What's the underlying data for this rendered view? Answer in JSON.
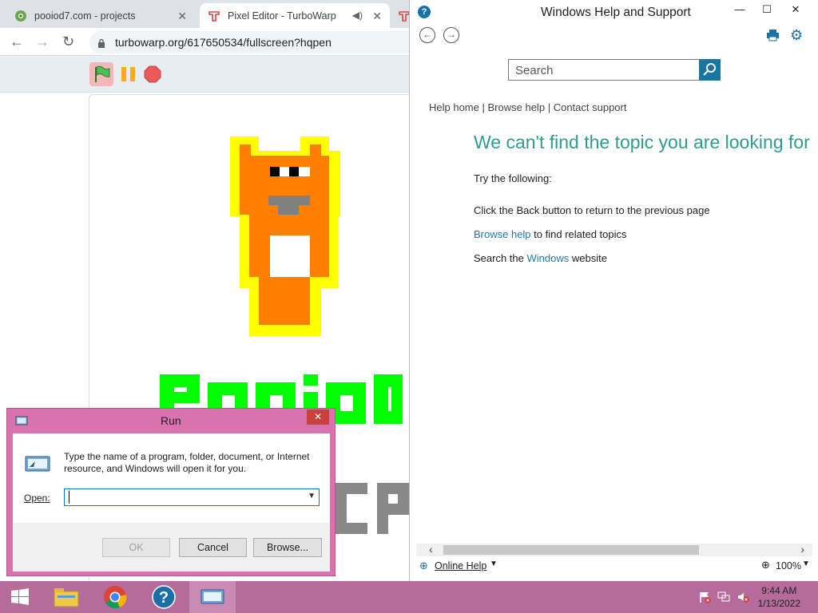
{
  "browser": {
    "tabs": [
      {
        "title": "pooiod7.com - projects",
        "active": false
      },
      {
        "title": "Pixel Editor - TurboWarp",
        "active": true
      }
    ],
    "url": "turbowarp.org/617650534/fullscreen?hqpen"
  },
  "stage": {
    "colors": {
      "orange": "#ff8000",
      "yellow": "#ffff00",
      "white": "#ffffff",
      "gray": "#808080",
      "black": "#000000",
      "green": "#00ff00",
      "text_gray": "#888888"
    }
  },
  "help": {
    "window_title": "Windows Help and Support",
    "search_placeholder": "Search",
    "nav_links": {
      "home": "Help home",
      "browse": "Browse help",
      "contact": "Contact support",
      "sep": "|"
    },
    "heading": "We can't find the topic you are looking for",
    "try_following": "Try the following:",
    "line_back": "Click the Back button to return to the previous page",
    "line_browse_link": "Browse help",
    "line_browse_rest": "to find related topics",
    "line_search_pre": "Search the",
    "line_search_link": "Windows",
    "line_search_post": "website",
    "status_online": "Online Help",
    "zoom": "100%",
    "accent": "#2f9c8c",
    "link_color": "#1f7aa8"
  },
  "run": {
    "title": "Run",
    "description": "Type the name of a program, folder, document, or Internet resource, and Windows will open it for you.",
    "open_label": "Open:",
    "open_value": "",
    "ok": "OK",
    "cancel": "Cancel",
    "browse": "Browse...",
    "frame_color": "#d973b0"
  },
  "taskbar": {
    "time": "9:44 AM",
    "date": "1/13/2022",
    "color": "#b56c9c"
  }
}
